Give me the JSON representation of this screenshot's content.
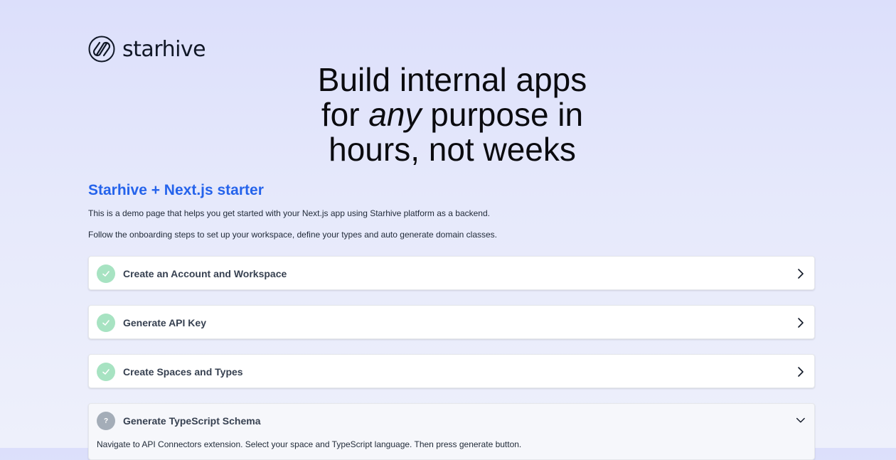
{
  "brand": {
    "name": "starhive"
  },
  "hero": {
    "line1": "Build internal apps",
    "line2_pre": "for",
    "line2_em": "any",
    "line2_post": "purpose in",
    "line3": "hours, not weeks"
  },
  "section": {
    "title": "Starhive + Next.js starter",
    "intro1": "This is a demo page that helps you get started with your Next.js app using Starhive platform as a backend.",
    "intro2": "Follow the onboarding steps to set up your workspace, define your types and auto generate domain classes."
  },
  "steps": [
    {
      "label": "Create an Account and Workspace",
      "status": "done",
      "status_icon": "check-icon",
      "expanded": false
    },
    {
      "label": "Generate API Key",
      "status": "done",
      "status_icon": "check-icon",
      "expanded": false
    },
    {
      "label": "Create Spaces and Types",
      "status": "done",
      "status_icon": "check-icon",
      "expanded": false
    },
    {
      "label": "Generate TypeScript Schema",
      "status": "pending",
      "status_icon": "question-icon",
      "status_glyph": "?",
      "expanded": true,
      "description": "Navigate to API Connectors extension. Select your space and TypeScript language. Then press generate button."
    }
  ],
  "colors": {
    "accent": "#2563eb",
    "done": "#a7e3c2",
    "pending": "#a4adb8"
  }
}
